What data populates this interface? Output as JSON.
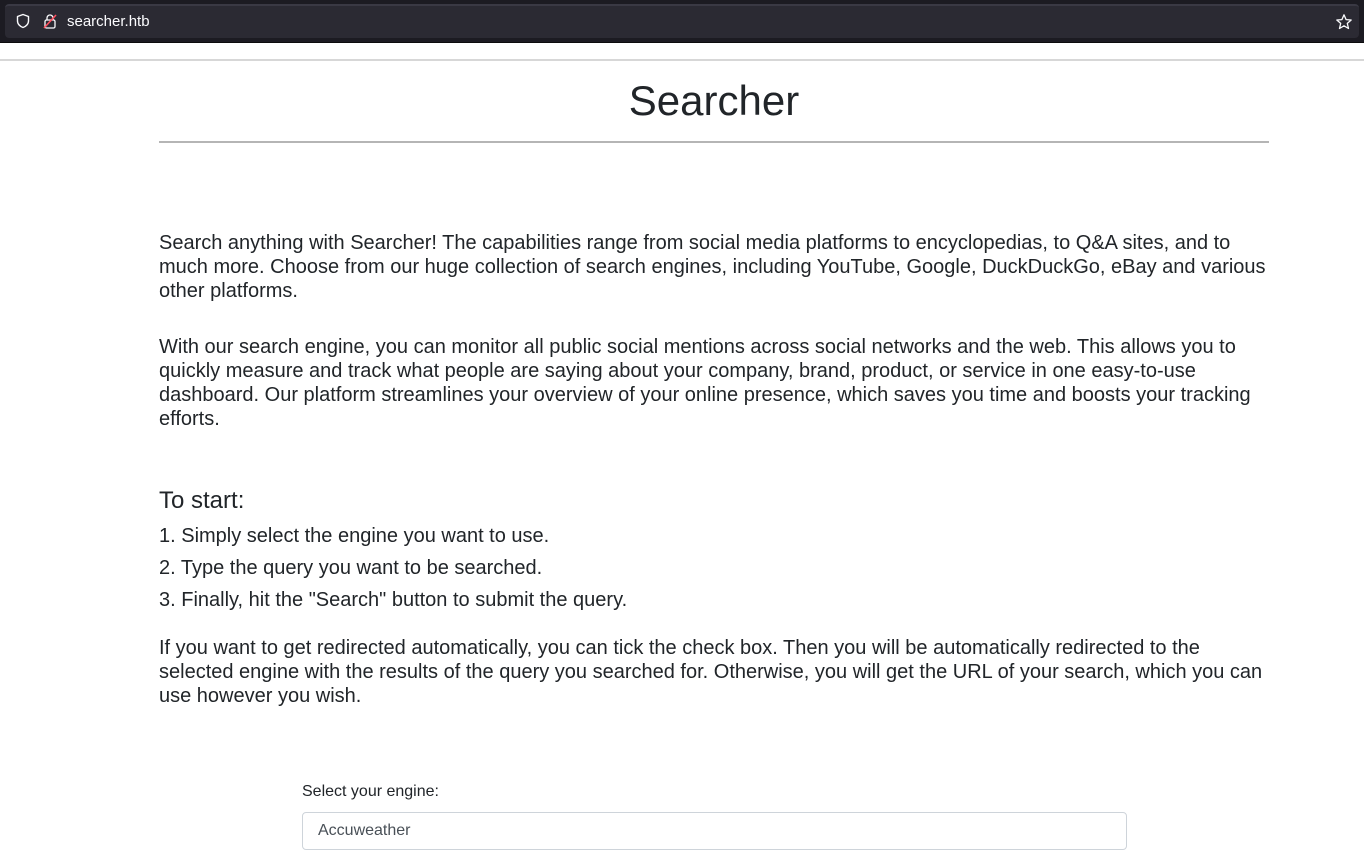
{
  "browser": {
    "url": "searcher.htb",
    "icons": [
      "shield-icon",
      "lock-icon",
      "star-icon"
    ]
  },
  "header": {
    "title": "Searcher"
  },
  "main": {
    "intro_paragraph": "Search anything with Searcher! The capabilities range from social media platforms to encyclopedias, to Q&A sites, and to much more. Choose from our huge collection of search engines, including YouTube, Google, DuckDuckGo, eBay and various other platforms.",
    "monitor_paragraph": "With our search engine, you can monitor all public social mentions across social networks and the web. This allows you to quickly measure and track what people are saying about your company, brand, product, or service in one easy-to-use dashboard. Our platform streamlines your overview of your online presence, which saves you time and boosts your tracking efforts.",
    "start_heading": "To start:",
    "steps": [
      "1. Simply select the engine you want to use.",
      "2. Type the query you want to be searched.",
      "3. Finally, hit the \"Search\" button to submit the query."
    ],
    "redirect_paragraph": "If you want to get redirected automatically, you can tick the check box. Then you will be automatically redirected to the selected engine with the results of the query you searched for. Otherwise, you will get the URL of your search, which you can use however you wish."
  },
  "form": {
    "engine_label": "Select your engine:",
    "engine_selected": "Accuweather"
  }
}
